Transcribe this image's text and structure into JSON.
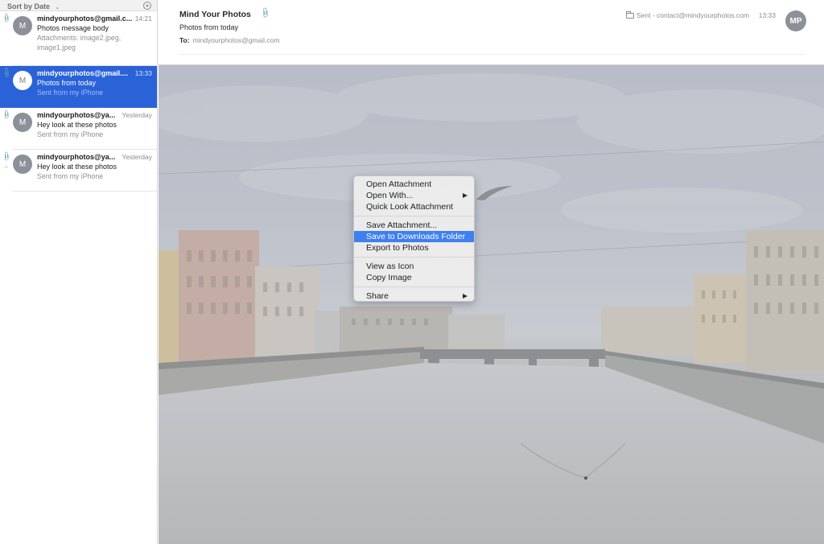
{
  "sidebar": {
    "sort_label": "Sort by Date",
    "messages": [
      {
        "sender": "mindyourphotos@gmail.c...",
        "time": "14:21",
        "subject": "Photos message body",
        "preview": "Attachments: image2.jpeg, image1.jpeg",
        "avatar": "M",
        "has_attachment": true,
        "forwarded": false,
        "selected": false
      },
      {
        "sender": "mindyourphotos@gmail....",
        "time": "13:33",
        "subject": "Photos from today",
        "preview": "Sent from my iPhone",
        "avatar": "M",
        "has_attachment": true,
        "forwarded": false,
        "selected": true
      },
      {
        "sender": "mindyourphotos@ya...",
        "time": "Yesterday",
        "subject": "Hey look at these photos",
        "preview": "Sent from my iPhone",
        "avatar": "M",
        "has_attachment": true,
        "forwarded": false,
        "selected": false
      },
      {
        "sender": "mindyourphotos@ya...",
        "time": "Yesterday",
        "subject": "Hey look at these photos",
        "preview": "Sent from my iPhone",
        "avatar": "M",
        "has_attachment": true,
        "forwarded": true,
        "selected": false
      }
    ]
  },
  "header": {
    "from": "Mind Your Photos",
    "subject": "Photos from today",
    "to_label": "To:",
    "to": "mindyourphotos@gmail.com",
    "mailbox": "Sent - contact@mindyourphotos.com",
    "time": "13:33",
    "avatar": "MP"
  },
  "context_menu": {
    "groups": [
      [
        {
          "label": "Open Attachment",
          "submenu": false
        },
        {
          "label": "Open With...",
          "submenu": true
        },
        {
          "label": "Quick Look Attachment",
          "submenu": false
        }
      ],
      [
        {
          "label": "Save Attachment...",
          "submenu": false
        },
        {
          "label": "Save to Downloads Folder",
          "submenu": false,
          "highlighted": true
        },
        {
          "label": "Export to Photos",
          "submenu": false
        }
      ],
      [
        {
          "label": "View as Icon",
          "submenu": false
        },
        {
          "label": "Copy Image",
          "submenu": false
        }
      ],
      [
        {
          "label": "Share",
          "submenu": true
        }
      ]
    ]
  },
  "colors": {
    "selection_blue": "#2a62d8",
    "menu_highlight": "#3f7ff0",
    "avatar_gray": "#8c9099"
  },
  "attachment": {
    "description": "Photo of a canal with a bridge and buildings under a cloudy sky"
  }
}
